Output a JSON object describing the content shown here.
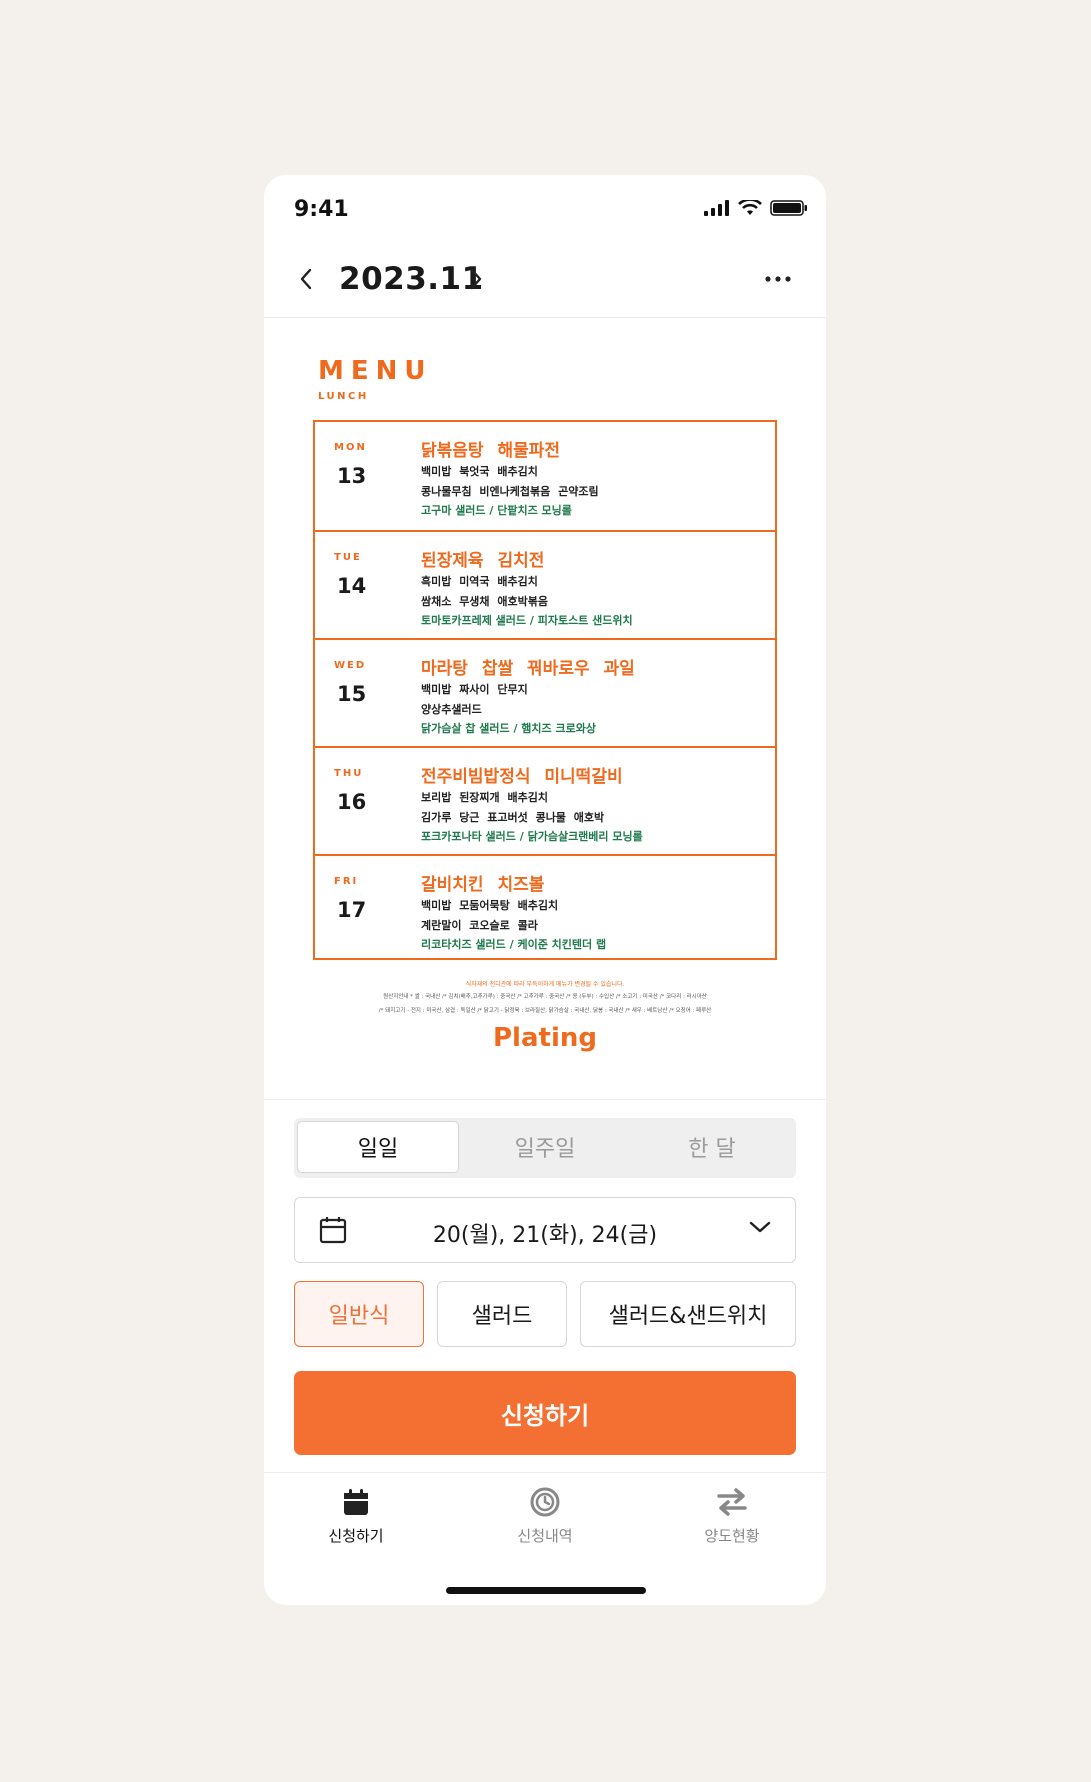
{
  "status": {
    "time": "9:41"
  },
  "header": {
    "month": "2023.11"
  },
  "menu": {
    "heading": "MENU",
    "subheading": "LUNCH",
    "days": [
      {
        "day": "MON",
        "date": "13",
        "main": "닭볶음탕 해물파전",
        "line1": "백미밥 북엇국 배추김치",
        "line2": "콩나물무침 비엔나케첩볶음 곤약조림",
        "salad": "고구마 샐러드 / 단팥치즈 모닝롤"
      },
      {
        "day": "TUE",
        "date": "14",
        "main": "된장제육 김치전",
        "line1": "흑미밥 미역국 배추김치",
        "line2": "쌈채소 무생채 애호박볶음",
        "salad": "토마토카프레제 샐러드 / 피자토스트 샌드위치"
      },
      {
        "day": "WED",
        "date": "15",
        "main": "마라탕 찹쌀 꿔바로우 과일",
        "line1": "백미밥 짜사이 단무지",
        "line2": "양상추샐러드",
        "salad": "닭가슴살 찹 샐러드 / 햄치즈 크로와상"
      },
      {
        "day": "THU",
        "date": "16",
        "main": "전주비빔밥정식 미니떡갈비",
        "line1": "보리밥 된장찌개 배추김치",
        "line2": "김가루 당근 표고버섯 콩나물 애호박",
        "salad": "포크카포나타 샐러드 / 닭가슴살크랜베리 모닝롤"
      },
      {
        "day": "FRI",
        "date": "17",
        "main": "갈비치킨 치즈볼",
        "line1": "백미밥 모둠어묵탕 배추김치",
        "line2": "계란말이 코오슬로 콜라",
        "salad": "리코타치즈 샐러드 / 케이준 치킨텐더 랩"
      }
    ],
    "notice": "식자재의 천디관에 따라 부득이하게 메뉴가 변경될 수 있습니다.",
    "origin1": "원산지안내 * 쌀 : 국내산 /* 김치(배추,고추가루) : 중국산 /* 고추가루 : 중국산 /* 콩 (두부) : 수입산 /* 소고기 : 미국산 /* 코다리 : 러시아산",
    "origin2": "/* 돼지고기 - 전지 : 미국산, 삼겹 : 독일산 /* 닭고기 - 닭정육 : 브라질산, 닭가슴살 : 국내산, 닭봉 : 국내산 /* 새우 : 베트남산 /* 오징어 : 페루산",
    "brand": "Plating"
  },
  "period_tabs": [
    {
      "label": "일일",
      "active": true
    },
    {
      "label": "일주일",
      "active": false
    },
    {
      "label": "한 달",
      "active": false
    }
  ],
  "date_select": {
    "value": "20(월), 21(화), 24(금)",
    "icon": "calendar-icon",
    "chevron": "chevron-down-icon"
  },
  "meal_types": [
    {
      "label": "일반식",
      "active": true
    },
    {
      "label": "샐러드",
      "active": false
    },
    {
      "label": "샐러드&샌드위치",
      "active": false
    }
  ],
  "submit_label": "신청하기",
  "tabbar": [
    {
      "label": "신청하기",
      "icon": "calendar-icon",
      "active": true
    },
    {
      "label": "신청내역",
      "icon": "history-icon",
      "active": false
    },
    {
      "label": "양도현황",
      "icon": "transfer-icon",
      "active": false
    }
  ],
  "colors": {
    "accent": "#f46f32",
    "menu_orange": "#ef6a1d",
    "salad_green": "#1f7a4c"
  }
}
